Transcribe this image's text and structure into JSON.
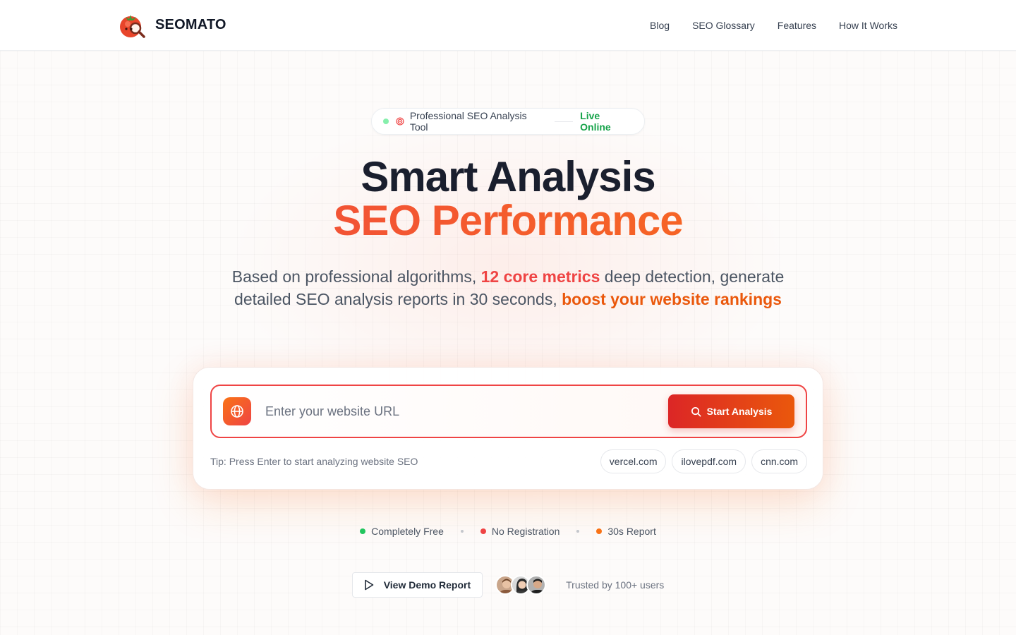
{
  "header": {
    "brand": "SEOMATO",
    "nav": [
      {
        "label": "Blog"
      },
      {
        "label": "SEO Glossary"
      },
      {
        "label": "Features"
      },
      {
        "label": "How It Works"
      }
    ]
  },
  "badge": {
    "text": "Professional SEO Analysis Tool",
    "status": "Live Online"
  },
  "hero": {
    "title_line1": "Smart Analysis",
    "title_line2": "SEO Performance",
    "subtitle_part1": "Based on professional algorithms, ",
    "subtitle_highlight1": "12 core metrics",
    "subtitle_part2": " deep detection, generate detailed SEO analysis reports in 30 seconds, ",
    "subtitle_highlight2": "boost your website rankings"
  },
  "search": {
    "placeholder": "Enter your website URL",
    "value": "",
    "button_label": "Start Analysis",
    "tip": "Tip: Press Enter to start analyzing website SEO",
    "examples": [
      "vercel.com",
      "ilovepdf.com",
      "cnn.com"
    ]
  },
  "features": [
    {
      "label": "Completely Free",
      "color": "#22c55e"
    },
    {
      "label": "No Registration",
      "color": "#ef4444"
    },
    {
      "label": "30s Report",
      "color": "#f97316"
    }
  ],
  "bottom": {
    "demo_label": "View Demo Report",
    "trusted": "Trusted by 100+ users"
  },
  "colors": {
    "accent_red": "#ef4444",
    "accent_orange": "#f97316",
    "live_green": "#16a34a"
  }
}
